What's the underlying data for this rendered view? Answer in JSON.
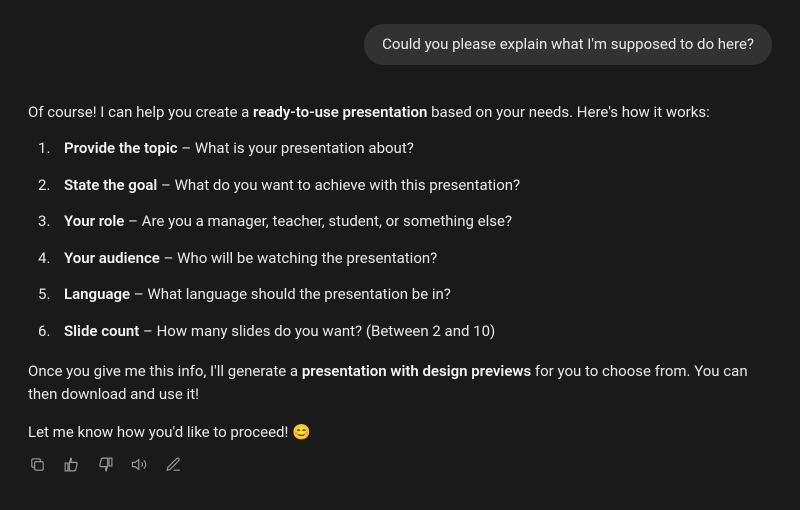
{
  "user": {
    "message": "Could you please explain what I'm supposed to do here?"
  },
  "assistant": {
    "intro_before": "Of course! I can help you create a ",
    "intro_bold": "ready-to-use presentation",
    "intro_after": " based on your needs. Here's how it works:",
    "steps": [
      {
        "title": "Provide the topic",
        "desc": " – What is your presentation about?"
      },
      {
        "title": "State the goal",
        "desc": " – What do you want to achieve with this presentation?"
      },
      {
        "title": "Your role",
        "desc": " – Are you a manager, teacher, student, or something else?"
      },
      {
        "title": "Your audience",
        "desc": " – Who will be watching the presentation?"
      },
      {
        "title": "Language",
        "desc": " – What language should the presentation be in?"
      },
      {
        "title": "Slide count",
        "desc": " – How many slides do you want? (Between 2 and 10)"
      }
    ],
    "outro1_before": "Once you give me this info, I'll generate a ",
    "outro1_bold": "presentation with design previews",
    "outro1_after": " for you to choose from. You can then download and use it!",
    "outro2": "Let me know how you'd like to proceed! 😊"
  }
}
